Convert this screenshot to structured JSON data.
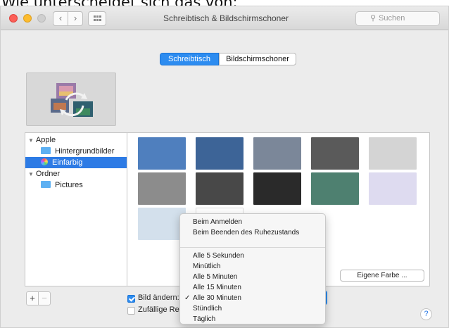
{
  "caption": "Wie unterscheidet sich das von:",
  "window": {
    "title": "Schreibtisch & Bildschirmschoner",
    "search_placeholder": "Suchen",
    "nav": {
      "back": "‹",
      "forward": "›"
    }
  },
  "tabs": [
    {
      "label": "Schreibtisch",
      "selected": true
    },
    {
      "label": "Bildschirmschoner",
      "selected": false
    }
  ],
  "sidebar": {
    "groups": [
      {
        "label": "Apple",
        "items": [
          {
            "label": "Hintergrundbilder",
            "icon": "folder-icon"
          },
          {
            "label": "Einfarbig",
            "icon": "color-ball-icon",
            "selected": true
          }
        ]
      },
      {
        "label": "Ordner",
        "items": [
          {
            "label": "Pictures",
            "icon": "folder-icon"
          }
        ]
      }
    ]
  },
  "swatches": [
    "#4f7fbe",
    "#3d6497",
    "#7b8799",
    "#5a5a5a",
    "#d4d4d4",
    "#8c8c8c",
    "#484848",
    "#2a2a2a",
    "#4e8070",
    "#dedbf0",
    "#d3e0ec",
    "#ffffff"
  ],
  "custom_color_button": "Eigene Farbe ...",
  "add_button": "+",
  "remove_button": "−",
  "change_picture_label": "Bild ändern:",
  "random_order_label": "Zufällige Re",
  "help_button": "?",
  "menu": {
    "items_top": [
      "Beim Anmelden",
      "Beim Beenden des Ruhezustands"
    ],
    "items_bottom": [
      {
        "label": "Alle 5 Sekunden"
      },
      {
        "label": "Minütlich"
      },
      {
        "label": "Alle 5 Minuten"
      },
      {
        "label": "Alle 15 Minuten"
      },
      {
        "label": "Alle 30 Minuten",
        "checked": true,
        "check_mark": "✓"
      },
      {
        "label": "Stündlich"
      },
      {
        "label": "Täglich"
      }
    ]
  },
  "colors": {
    "accent": "#2d8cf0",
    "sidebar_selection": "#2d7be5",
    "traffic_red": "#fc5f57",
    "traffic_yellow": "#fdbc2e"
  }
}
